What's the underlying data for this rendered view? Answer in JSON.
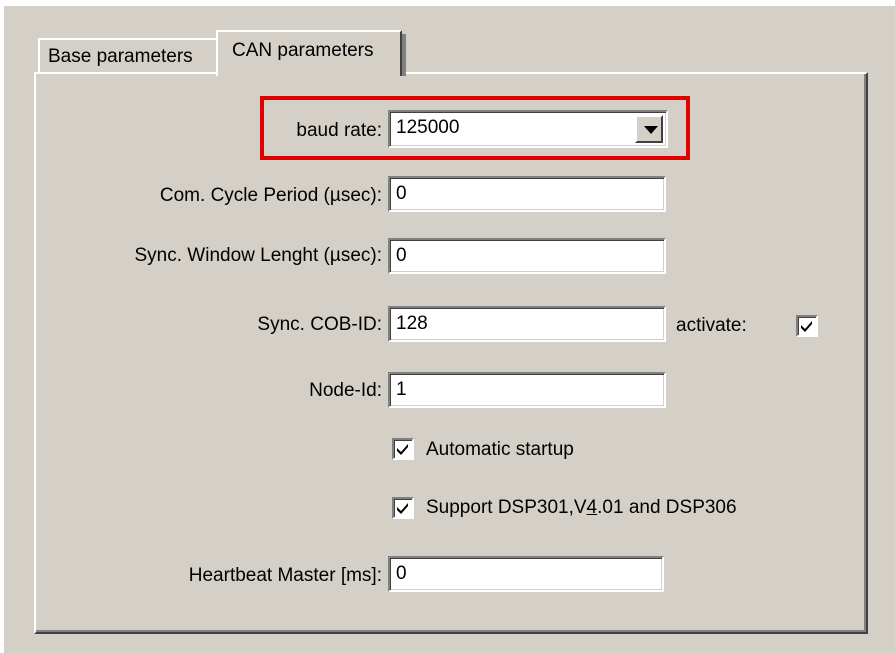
{
  "tabs": [
    {
      "label": "Base parameters"
    },
    {
      "label": "CAN parameters"
    }
  ],
  "form": {
    "baud_rate": {
      "label": "baud rate:",
      "value": "125000"
    },
    "com_cycle_period": {
      "label": "Com. Cycle Period (µsec):",
      "value": "0"
    },
    "sync_window_length": {
      "label": "Sync. Window Lenght (µsec):",
      "value": "0"
    },
    "sync_cob_id": {
      "label": "Sync. COB-ID:",
      "value": "128"
    },
    "activate": {
      "label": "activate:",
      "checked": true
    },
    "node_id": {
      "label": "Node-Id:",
      "value": "1"
    },
    "automatic_startup": {
      "label": "Automatic startup",
      "checked": true
    },
    "support_dsp": {
      "label_pre": "Support DSP301,V",
      "label_accel": "4",
      "label_post": ".01 and DSP306",
      "checked": true
    },
    "heartbeat_master": {
      "label": "Heartbeat Master [ms]:",
      "value": "0"
    }
  },
  "colors": {
    "dialog_bg": "#d4d0c8",
    "highlight": "#e00000"
  }
}
